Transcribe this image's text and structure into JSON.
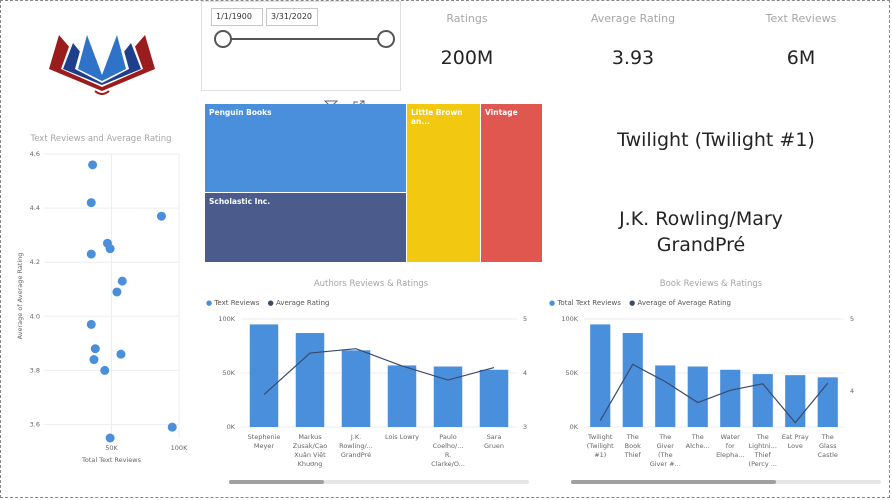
{
  "slicer": {
    "start": "1/1/1900",
    "end": "3/31/2020"
  },
  "kpis": [
    {
      "label": "Ratings",
      "value": "200M"
    },
    {
      "label": "Average Rating",
      "value": "3.93"
    },
    {
      "label": "Text Reviews",
      "value": "6M"
    }
  ],
  "treemap": {
    "tiles": [
      {
        "label": "Penguin Books",
        "color": "#4a8fdb"
      },
      {
        "label": "Scholastic Inc.",
        "color": "#4a5b8c"
      },
      {
        "label": "Little Brown an...",
        "color": "#f2c811"
      },
      {
        "label": "Vintage",
        "color": "#e0574f"
      }
    ]
  },
  "cards": {
    "top_book": "Twilight (Twilight #1)",
    "top_author": "J.K. Rowling/Mary GrandPré"
  },
  "colors": {
    "bar": "#4a8fdb",
    "line": "#3b4a6b"
  },
  "chart_data": [
    {
      "type": "scatter",
      "title": "Text Reviews and Average Rating",
      "xlabel": "Total Text Reviews",
      "ylabel": "Average of Average Rating",
      "xlim": [
        0,
        100000
      ],
      "ylim": [
        3.55,
        4.6
      ],
      "xticks": [
        {
          "v": 50000,
          "label": "50K"
        },
        {
          "v": 100000,
          "label": "100K"
        }
      ],
      "yticks": [
        3.6,
        3.8,
        4.0,
        4.2,
        4.4,
        4.6
      ],
      "ytick_labels": [
        "3.6",
        "3.8",
        "4.0",
        "4.2",
        "4.4",
        "4.6"
      ],
      "points": [
        {
          "x": 36000,
          "y": 4.56
        },
        {
          "x": 35000,
          "y": 4.42
        },
        {
          "x": 87000,
          "y": 4.37
        },
        {
          "x": 47000,
          "y": 4.27
        },
        {
          "x": 49000,
          "y": 4.25
        },
        {
          "x": 35000,
          "y": 4.23
        },
        {
          "x": 58000,
          "y": 4.13
        },
        {
          "x": 54000,
          "y": 4.09
        },
        {
          "x": 35000,
          "y": 3.97
        },
        {
          "x": 38000,
          "y": 3.88
        },
        {
          "x": 57000,
          "y": 3.86
        },
        {
          "x": 37000,
          "y": 3.84
        },
        {
          "x": 45000,
          "y": 3.8
        },
        {
          "x": 49000,
          "y": 3.55
        },
        {
          "x": 95000,
          "y": 3.59
        }
      ]
    },
    {
      "type": "bar",
      "title": "Authors Reviews & Ratings",
      "categories": [
        "Stephenie Meyer",
        "Markus Zusak/Cao Xuân Việt Khương",
        "J.K. Rowling/... GrandPré",
        "Lois Lowry",
        "Paulo Coelho/... R. Clarke/O...",
        "Sara Gruen"
      ],
      "category_lines": [
        [
          "Stephenie",
          "Meyer"
        ],
        [
          "Markus",
          "Zusak/Cao",
          "Xuân Việt",
          "Khương"
        ],
        [
          "J.K.",
          "Rowling/...",
          "GrandPré"
        ],
        [
          "Lois Lowry"
        ],
        [
          "Paulo",
          "Coelho/...",
          "R.",
          "Clarke/O..."
        ],
        [
          "Sara",
          "Gruen"
        ]
      ],
      "yticks_left": [
        "0K",
        "50K",
        "100K"
      ],
      "yticks_right": [
        "3",
        "4",
        "5"
      ],
      "ylim_left": [
        0,
        100000
      ],
      "ylim_right": [
        3,
        5
      ],
      "series": [
        {
          "name": "Text Reviews",
          "kind": "bar",
          "values": [
            95000,
            87000,
            71000,
            57000,
            56000,
            53000
          ]
        },
        {
          "name": "Average Rating",
          "kind": "line",
          "values": [
            3.6,
            4.37,
            4.45,
            4.13,
            3.87,
            4.1
          ]
        }
      ]
    },
    {
      "type": "bar",
      "title": "Book Reviews & Ratings",
      "categories": [
        "Twilight (Twilight #1)",
        "The Book Thief",
        "The Giver (The Giver #...",
        "The Alche...",
        "Water for Elepha...",
        "The Lightni... Thief (Percy ...",
        "Eat Pray Love",
        "The Glass Castle"
      ],
      "category_lines": [
        [
          "Twilight",
          "(Twilight",
          "#1)"
        ],
        [
          "The",
          "Book",
          "Thief"
        ],
        [
          "The",
          "Giver",
          "(The",
          "Giver #..."
        ],
        [
          "The",
          "Alche..."
        ],
        [
          "Water",
          "for",
          "Elepha..."
        ],
        [
          "The",
          "Lightni...",
          "Thief",
          "(Percy ..."
        ],
        [
          "Eat Pray",
          "Love"
        ],
        [
          "The",
          "Glass",
          "Castle"
        ]
      ],
      "yticks_left": [
        "0K",
        "50K",
        "100K"
      ],
      "yticks_right": [
        "4",
        "5"
      ],
      "ylim_left": [
        0,
        100000
      ],
      "ylim_right": [
        3.5,
        5
      ],
      "series": [
        {
          "name": "Total Text Reviews",
          "kind": "bar",
          "values": [
            95000,
            87000,
            57000,
            56000,
            53000,
            49000,
            48000,
            46000
          ]
        },
        {
          "name": "Average of Average Rating",
          "kind": "line",
          "values": [
            3.59,
            4.37,
            4.13,
            3.84,
            4.01,
            4.1,
            3.56,
            4.11
          ]
        }
      ]
    }
  ]
}
